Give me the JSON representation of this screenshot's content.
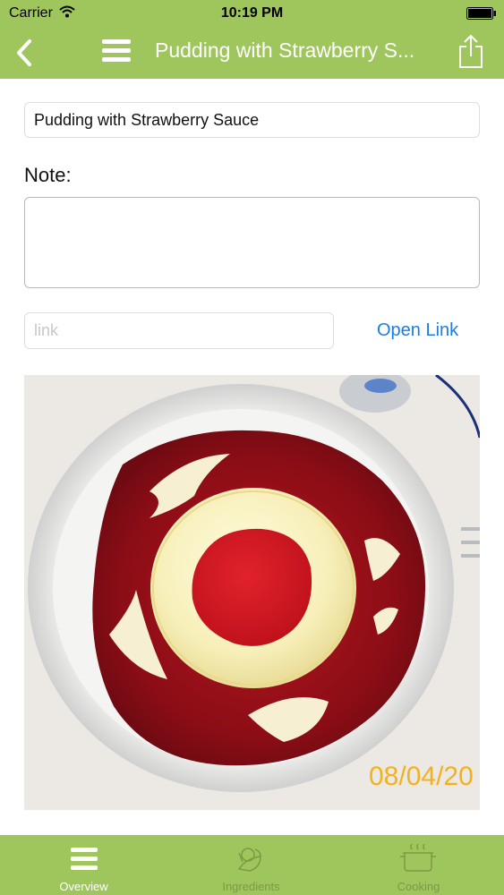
{
  "status_bar": {
    "carrier": "Carrier",
    "time": "10:19 PM"
  },
  "nav": {
    "title": "Pudding with Strawberry S...",
    "back_icon": "chevron-left-icon",
    "menu_icon": "hamburger-menu-icon",
    "share_icon": "share-icon"
  },
  "form": {
    "title_value": "Pudding with Strawberry Sauce",
    "note_label": "Note:",
    "note_value": "",
    "link_placeholder": "link",
    "open_link_label": "Open Link"
  },
  "photo": {
    "date_stamp": "08/04/20",
    "description_icon": "recipe-photo"
  },
  "tabs": [
    {
      "label": "Overview",
      "icon": "hamburger-menu-icon",
      "active": true
    },
    {
      "label": "Ingredients",
      "icon": "ingredients-icon",
      "active": false
    },
    {
      "label": "Cooking",
      "icon": "cooking-pot-icon",
      "active": false
    }
  ],
  "colors": {
    "brand_green": "#9fc65c",
    "link_blue": "#1a7ee6",
    "inactive_tab": "#7b9a44"
  }
}
